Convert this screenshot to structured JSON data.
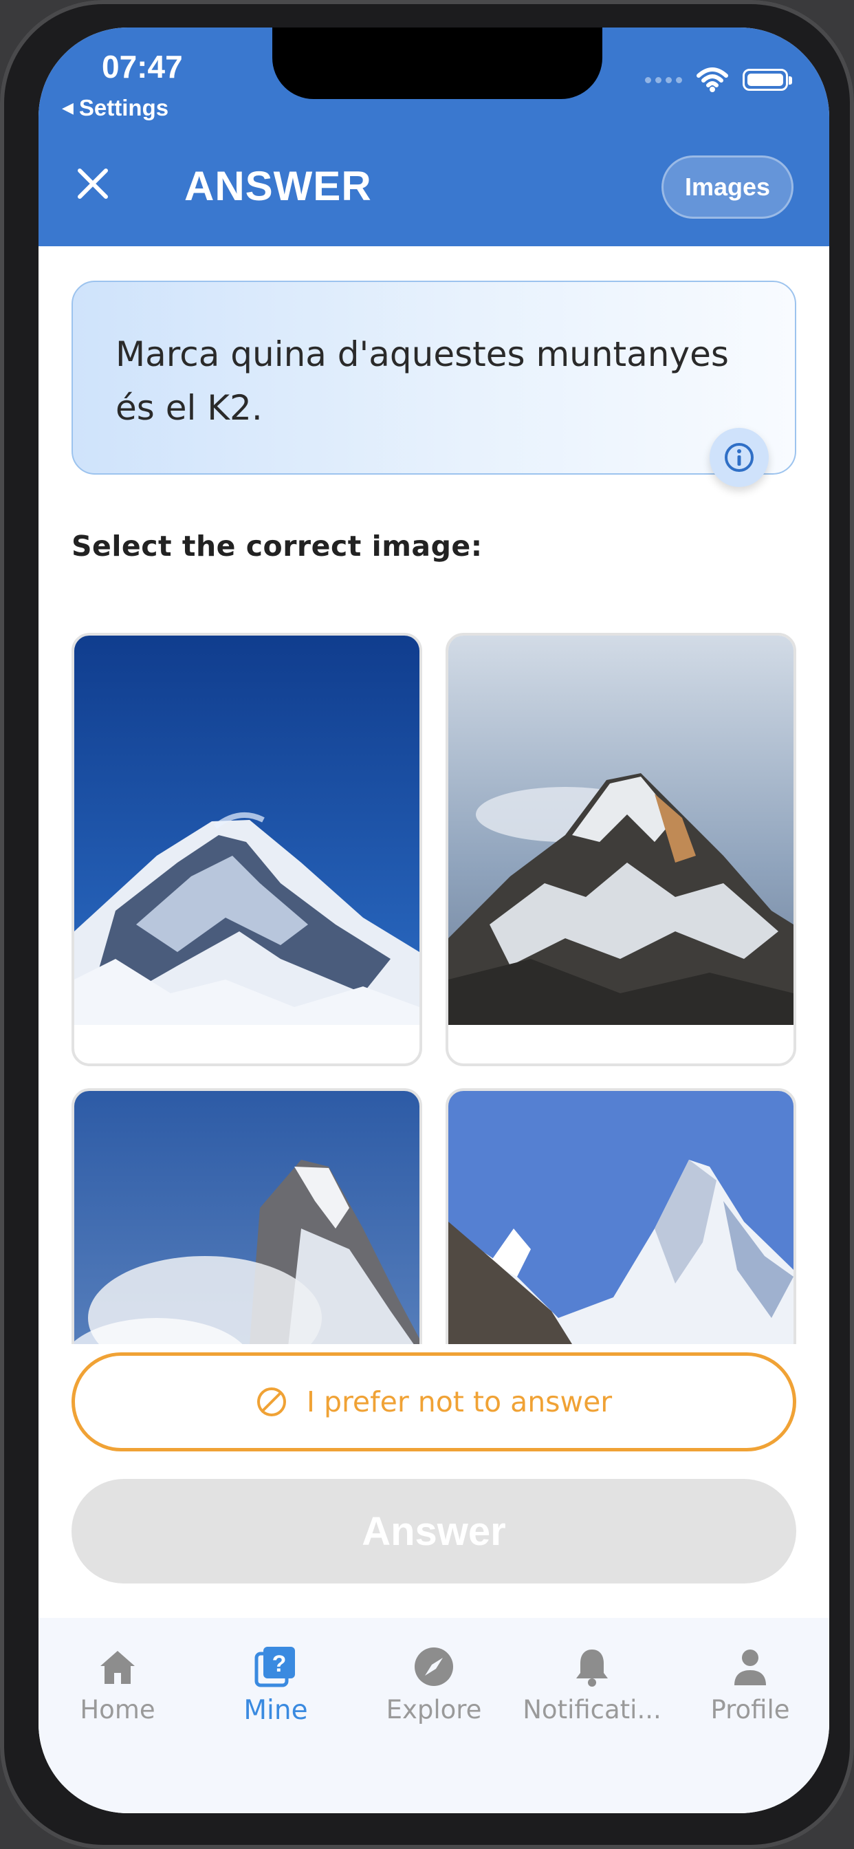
{
  "status_bar": {
    "time": "07:47",
    "back_label": "Settings",
    "back_glyph": "◀"
  },
  "header": {
    "title": "ANSWER",
    "images_button": "Images",
    "close_icon": "close-icon"
  },
  "question": {
    "text": "Marca quina d'aquestes muntanyes és el K2.",
    "info_icon": "info-icon"
  },
  "select_label": "Select the correct image:",
  "options": [
    {
      "id": "option-1",
      "depicts": "snowy mountain under deep blue sky"
    },
    {
      "id": "option-2",
      "depicts": "rocky snowy peak with clouds"
    },
    {
      "id": "option-3",
      "depicts": "sharp summit with cloud plume"
    },
    {
      "id": "option-4",
      "depicts": "pyramid-shaped snowy peak"
    }
  ],
  "actions": {
    "skip_label": "I prefer not to answer",
    "answer_label": "Answer"
  },
  "tabs": [
    {
      "label": "Home",
      "icon": "home-icon",
      "active": false
    },
    {
      "label": "Mine",
      "icon": "question-box-icon",
      "active": true
    },
    {
      "label": "Explore",
      "icon": "compass-icon",
      "active": false
    },
    {
      "label": "Notificati...",
      "icon": "bell-icon",
      "active": false
    },
    {
      "label": "Profile",
      "icon": "person-icon",
      "active": false
    }
  ],
  "colors": {
    "header_blue": "#3a78cf",
    "accent_orange": "#f0a235",
    "active_tab": "#3a8ae0",
    "disabled_button": "#e2e2e2"
  }
}
